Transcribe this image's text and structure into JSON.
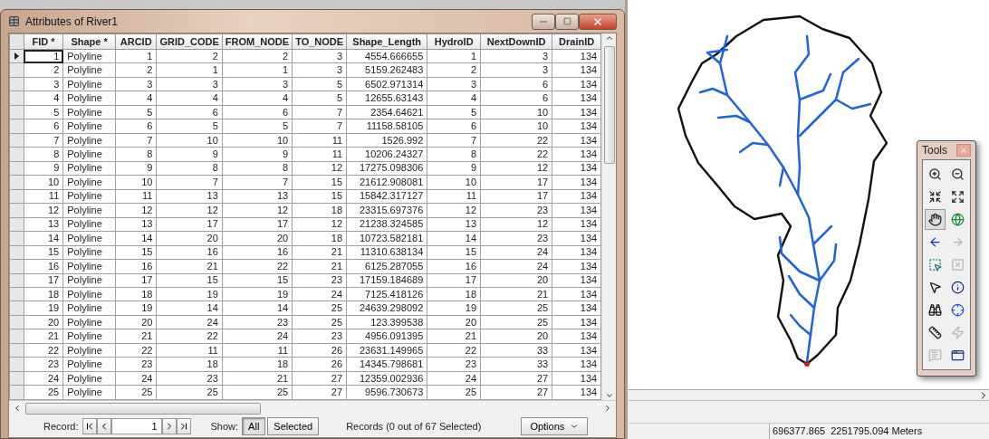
{
  "window": {
    "title": "Attributes of River1"
  },
  "table": {
    "columns": [
      {
        "label": "FID *",
        "kind": "number"
      },
      {
        "label": "Shape *",
        "kind": "text"
      },
      {
        "label": "ARCID",
        "kind": "number"
      },
      {
        "label": "GRID_CODE",
        "kind": "number"
      },
      {
        "label": "FROM_NODE",
        "kind": "number"
      },
      {
        "label": "TO_NODE",
        "kind": "number"
      },
      {
        "label": "Shape_Length",
        "kind": "number"
      },
      {
        "label": "HydroID",
        "kind": "number"
      },
      {
        "label": "NextDownID",
        "kind": "number"
      },
      {
        "label": "DrainID",
        "kind": "number"
      }
    ],
    "rows": [
      {
        "current": true,
        "cells": [
          "1",
          "Polyline",
          "1",
          "2",
          "2",
          "3",
          "4554.666655",
          "1",
          "3",
          "134"
        ]
      },
      {
        "current": false,
        "cells": [
          "2",
          "Polyline",
          "2",
          "1",
          "1",
          "3",
          "5159.262483",
          "2",
          "3",
          "134"
        ]
      },
      {
        "current": false,
        "cells": [
          "3",
          "Polyline",
          "3",
          "3",
          "3",
          "5",
          "6502.971314",
          "3",
          "6",
          "134"
        ]
      },
      {
        "current": false,
        "cells": [
          "4",
          "Polyline",
          "4",
          "4",
          "4",
          "5",
          "12655.63143",
          "4",
          "6",
          "134"
        ]
      },
      {
        "current": false,
        "cells": [
          "5",
          "Polyline",
          "5",
          "6",
          "6",
          "7",
          "2354.64621",
          "5",
          "10",
          "134"
        ]
      },
      {
        "current": false,
        "cells": [
          "6",
          "Polyline",
          "6",
          "5",
          "5",
          "7",
          "11158.58105",
          "6",
          "10",
          "134"
        ]
      },
      {
        "current": false,
        "cells": [
          "7",
          "Polyline",
          "7",
          "10",
          "10",
          "11",
          "1526.992",
          "7",
          "22",
          "134"
        ]
      },
      {
        "current": false,
        "cells": [
          "8",
          "Polyline",
          "8",
          "9",
          "9",
          "11",
          "10206.24327",
          "8",
          "22",
          "134"
        ]
      },
      {
        "current": false,
        "cells": [
          "9",
          "Polyline",
          "9",
          "8",
          "8",
          "12",
          "17275.098306",
          "9",
          "12",
          "134"
        ]
      },
      {
        "current": false,
        "cells": [
          "10",
          "Polyline",
          "10",
          "7",
          "7",
          "15",
          "21612.908081",
          "10",
          "17",
          "134"
        ]
      },
      {
        "current": false,
        "cells": [
          "11",
          "Polyline",
          "11",
          "13",
          "13",
          "15",
          "15842.317127",
          "11",
          "17",
          "134"
        ]
      },
      {
        "current": false,
        "cells": [
          "12",
          "Polyline",
          "12",
          "12",
          "12",
          "18",
          "23315.697376",
          "12",
          "23",
          "134"
        ]
      },
      {
        "current": false,
        "cells": [
          "13",
          "Polyline",
          "13",
          "17",
          "17",
          "12",
          "21238.324585",
          "13",
          "12",
          "134"
        ]
      },
      {
        "current": false,
        "cells": [
          "14",
          "Polyline",
          "14",
          "20",
          "20",
          "18",
          "10723.582181",
          "14",
          "23",
          "134"
        ]
      },
      {
        "current": false,
        "cells": [
          "15",
          "Polyline",
          "15",
          "16",
          "16",
          "21",
          "11310.638134",
          "15",
          "24",
          "134"
        ]
      },
      {
        "current": false,
        "cells": [
          "16",
          "Polyline",
          "16",
          "21",
          "22",
          "21",
          "6125.287055",
          "16",
          "24",
          "134"
        ]
      },
      {
        "current": false,
        "cells": [
          "17",
          "Polyline",
          "17",
          "15",
          "15",
          "23",
          "17159.184689",
          "17",
          "20",
          "134"
        ]
      },
      {
        "current": false,
        "cells": [
          "18",
          "Polyline",
          "18",
          "19",
          "19",
          "24",
          "7125.418126",
          "18",
          "21",
          "134"
        ]
      },
      {
        "current": false,
        "cells": [
          "19",
          "Polyline",
          "19",
          "14",
          "14",
          "25",
          "24639.298092",
          "19",
          "25",
          "134"
        ]
      },
      {
        "current": false,
        "cells": [
          "20",
          "Polyline",
          "20",
          "24",
          "23",
          "25",
          "123.399538",
          "20",
          "25",
          "134"
        ]
      },
      {
        "current": false,
        "cells": [
          "21",
          "Polyline",
          "21",
          "22",
          "24",
          "23",
          "4956.091395",
          "21",
          "20",
          "134"
        ]
      },
      {
        "current": false,
        "cells": [
          "22",
          "Polyline",
          "22",
          "11",
          "11",
          "26",
          "23631.149965",
          "22",
          "33",
          "134"
        ]
      },
      {
        "current": false,
        "cells": [
          "23",
          "Polyline",
          "23",
          "18",
          "18",
          "26",
          "14345.798681",
          "23",
          "33",
          "134"
        ]
      },
      {
        "current": false,
        "cells": [
          "24",
          "Polyline",
          "24",
          "23",
          "21",
          "27",
          "12359.002936",
          "24",
          "27",
          "134"
        ]
      },
      {
        "current": false,
        "cells": [
          "25",
          "Polyline",
          "25",
          "25",
          "25",
          "27",
          "9596.730673",
          "25",
          "27",
          "134"
        ]
      }
    ]
  },
  "navigation": {
    "label": "Record:",
    "record": "1",
    "show_label": "Show:",
    "show": [
      {
        "label": "All",
        "selected": true
      },
      {
        "label": "Selected",
        "selected": false
      }
    ],
    "summary": "Records (0 out of 67 Selected)",
    "options": "Options"
  },
  "tools": {
    "title": "Tools",
    "items": [
      {
        "kind": "zoom-in",
        "selected": false,
        "disabled": false
      },
      {
        "kind": "zoom-out",
        "selected": false,
        "disabled": false
      },
      {
        "kind": "fixed-in",
        "selected": false,
        "disabled": false
      },
      {
        "kind": "fixed-out",
        "selected": false,
        "disabled": false
      },
      {
        "kind": "pan",
        "selected": true,
        "disabled": false
      },
      {
        "kind": "full-extent",
        "selected": false,
        "disabled": false
      },
      {
        "kind": "back",
        "selected": false,
        "disabled": false
      },
      {
        "kind": "forward",
        "selected": false,
        "disabled": true
      },
      {
        "kind": "select-features",
        "selected": false,
        "disabled": false
      },
      {
        "kind": "clear-selection",
        "selected": false,
        "disabled": true
      },
      {
        "kind": "select-elements",
        "selected": false,
        "disabled": false
      },
      {
        "kind": "identify",
        "selected": false,
        "disabled": false
      },
      {
        "kind": "find",
        "selected": false,
        "disabled": false
      },
      {
        "kind": "go-to-xy",
        "selected": false,
        "disabled": false
      },
      {
        "kind": "measure",
        "selected": false,
        "disabled": false
      },
      {
        "kind": "hyperlink",
        "selected": false,
        "disabled": true
      },
      {
        "kind": "html-popup",
        "selected": false,
        "disabled": true
      },
      {
        "kind": "viewer",
        "selected": false,
        "disabled": false
      }
    ]
  },
  "status_bar": {
    "coordinates": "696377.865  2251795.094 Meters"
  }
}
